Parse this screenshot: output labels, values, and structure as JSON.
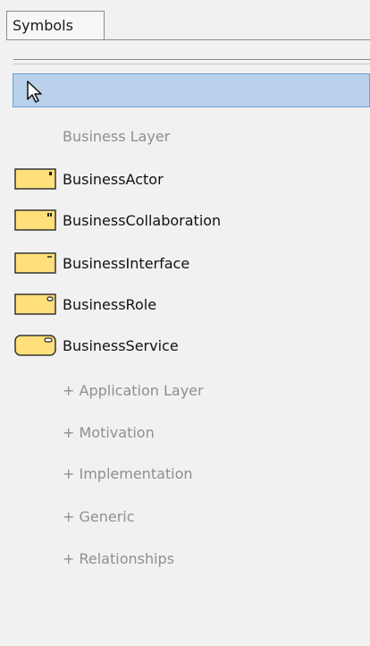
{
  "tab": {
    "label": "Symbols"
  },
  "groups": {
    "business": "Business Layer",
    "application": "+ Application Layer",
    "motivation": "+ Motivation",
    "implementation": "+ Implementation",
    "generic": "+ Generic",
    "relationships": "+ Relationships"
  },
  "items": [
    {
      "label": "BusinessActor",
      "icon": "business-actor-icon"
    },
    {
      "label": "BusinessCollaboration",
      "icon": "business-collaboration-icon"
    },
    {
      "label": "BusinessInterface",
      "icon": "business-interface-icon"
    },
    {
      "label": "BusinessRole",
      "icon": "business-role-icon"
    },
    {
      "label": "BusinessService",
      "icon": "business-service-icon"
    }
  ],
  "colors": {
    "icon_fill": "#ffe07a",
    "icon_stroke": "#333333",
    "selection": "#b9d1ea",
    "group_text": "#8f8f8f"
  }
}
